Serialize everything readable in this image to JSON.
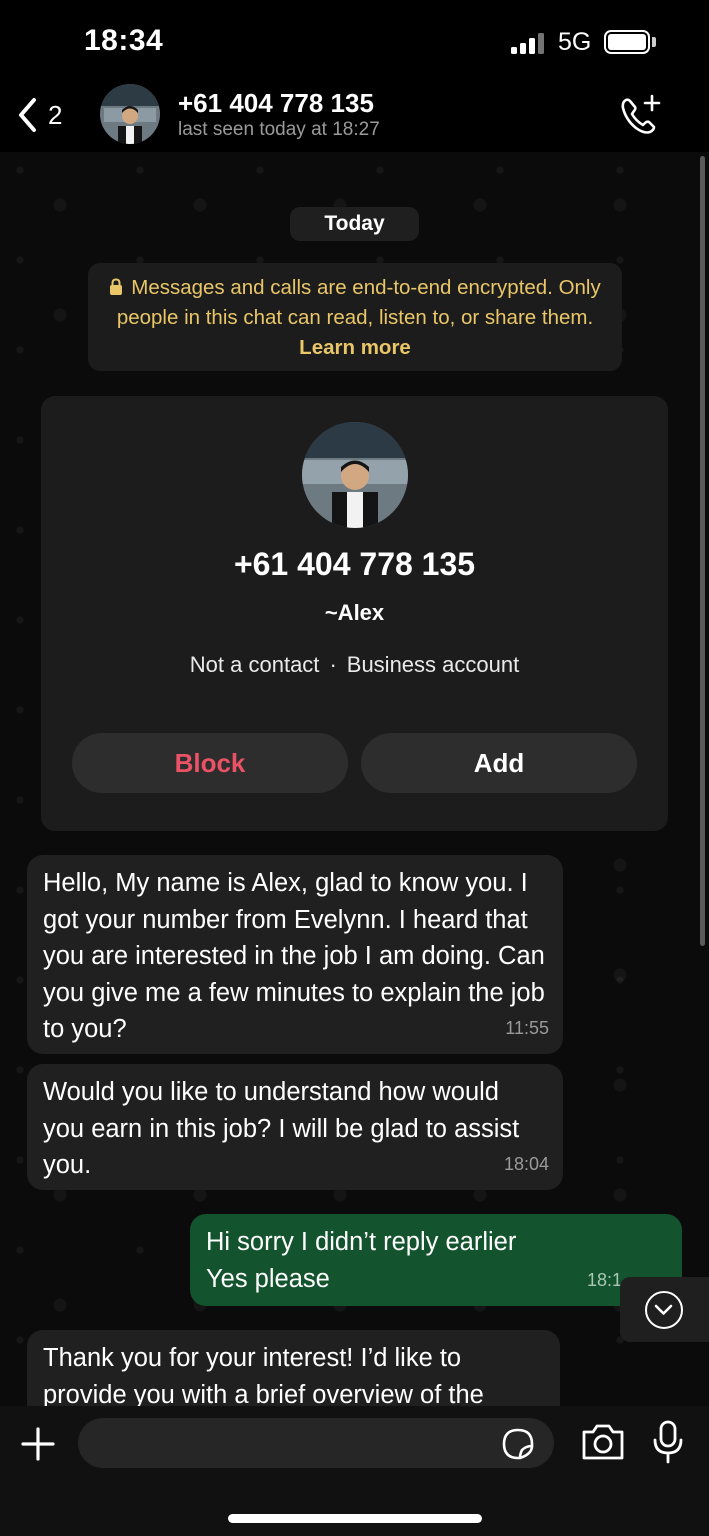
{
  "status_bar": {
    "time": "18:34",
    "network": "5G"
  },
  "header": {
    "back_count": "2",
    "contact_name": "+61 404 778 135",
    "last_seen": "last seen today at 18:27"
  },
  "date_separator": "Today",
  "encryption_notice": {
    "text": "Messages and calls are end-to-end encrypted. Only people in this chat can read, listen to, or share them.",
    "learn_more": "Learn more"
  },
  "contact_card": {
    "phone": "+61 404 778 135",
    "name": "~Alex",
    "status": "Not a contact",
    "account_type": "Business account",
    "block_label": "Block",
    "add_label": "Add"
  },
  "messages": [
    {
      "direction": "incoming",
      "text": "Hello, My name is Alex, glad to know you. I got your number from Evelynn. I heard that you are interested in the job I am doing. Can you give me a few minutes to explain the job to you?",
      "time": "11:55"
    },
    {
      "direction": "incoming",
      "text": "Would you like to understand how would you earn in this job? I will be glad to assist you.",
      "time": "18:04"
    },
    {
      "direction": "outgoing",
      "text": "Hi sorry I didn’t reply earlier\nYes please",
      "time": "18:1"
    },
    {
      "direction": "incoming",
      "text": "Thank you for your interest! I’d like to provide you with a brief overview of the",
      "time": ""
    }
  ],
  "colors": {
    "outgoing_bubble": "#13542e",
    "incoming_bubble": "#202020",
    "notice_text": "#e9c668",
    "block_red": "#eb5266"
  },
  "icons": [
    "back-chevron-icon",
    "call-add-icon",
    "lock-icon",
    "scroll-down-icon",
    "plus-icon",
    "sticker-icon",
    "camera-icon",
    "mic-icon"
  ]
}
